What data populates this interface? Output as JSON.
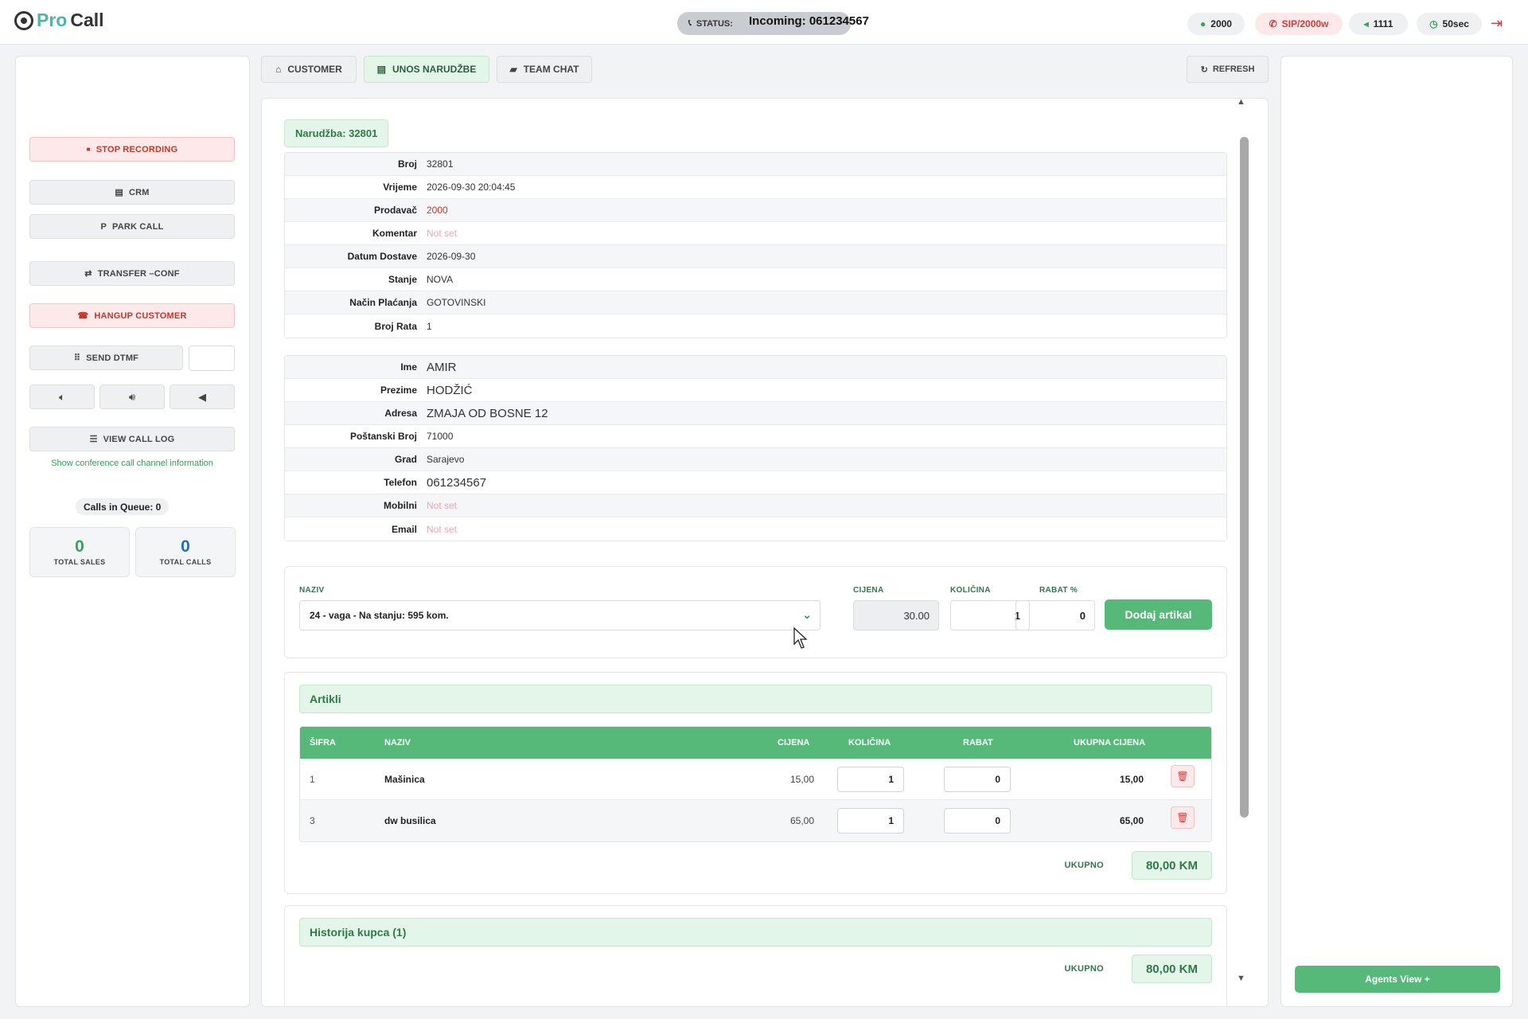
{
  "app": {
    "logo_pro": "Pro",
    "logo_call": "Call"
  },
  "topbar": {
    "status_label": "STATUS:",
    "status_value": "Incoming: 061234567",
    "agent": "2000",
    "sip": "SIP/2000w",
    "queue": "1111",
    "timer": "50sec"
  },
  "left": {
    "stop_recording": "STOP RECORDING",
    "crm": "CRM",
    "park_call": "PARK CALL",
    "transfer": "TRANSFER –CONF",
    "hangup": "HANGUP CUSTOMER",
    "send_dtmf": "SEND DTMF",
    "view_call_log": "VIEW CALL LOG",
    "conference_info": "Show conference call channel information",
    "calls_in_queue": "Calls in Queue: 0",
    "total_sales_value": "0",
    "total_sales_label": "TOTAL SALES",
    "total_calls_value": "0",
    "total_calls_label": "TOTAL CALLS"
  },
  "tabs": [
    {
      "label": "CUSTOMER"
    },
    {
      "label": "UNOS NARUDŽBE"
    },
    {
      "label": "TEAM CHAT"
    }
  ],
  "refresh_label": "REFRESH",
  "order": {
    "badge": "Narudžba: 32801",
    "rows": [
      {
        "label": "Broj",
        "value": "32801"
      },
      {
        "label": "Vrijeme",
        "value": "2026-09-30 20:04:45"
      },
      {
        "label": "Prodavač",
        "value": "2000"
      },
      {
        "label": "Komentar",
        "value": "Not set"
      },
      {
        "label": "Datum Dostave",
        "value": "2026-09-30"
      },
      {
        "label": "Stanje",
        "value": "NOVA"
      },
      {
        "label": "Način Plaćanja",
        "value": "GOTOVINSKI"
      },
      {
        "label": "Broj Rata",
        "value": "1"
      }
    ]
  },
  "customer": {
    "rows": [
      {
        "label": "Ime",
        "value": "AMIR"
      },
      {
        "label": "Prezime",
        "value": "HODŽIĆ"
      },
      {
        "label": "Adresa",
        "value": "ZMAJA OD BOSNE 12"
      },
      {
        "label": "Poštanski Broj",
        "value": "71000"
      },
      {
        "label": "Grad",
        "value": "Sarajevo"
      },
      {
        "label": "Telefon",
        "value": "061234567"
      },
      {
        "label": "Mobilni",
        "value": "Not set"
      },
      {
        "label": "Email",
        "value": "Not set"
      }
    ]
  },
  "add_item": {
    "naziv_label": "NAZIV",
    "cijena_label": "CIJENA",
    "kolicina_label": "KOLIČINA",
    "rabat_label": "RABAT %",
    "selected_product": "24 - vaga - Na stanju: 595 kom.",
    "cijena": "30.00",
    "kolicina": "1",
    "rabat": "0",
    "add_button": "Dodaj artikal"
  },
  "articles": {
    "title": "Artikli",
    "headers": {
      "sifra": "ŠIFRA",
      "naziv": "NAZIV",
      "cijena": "CIJENA",
      "kolicina": "KOLIČINA",
      "rabat": "RABAT",
      "ukupna": "UKUPNA CIJENA"
    },
    "rows": [
      {
        "sifra": "1",
        "naziv": "Mašinica",
        "cijena": "15,00",
        "kolicina": "1",
        "rabat": "0",
        "ukupna": "15,00"
      },
      {
        "sifra": "3",
        "naziv": "dw busilica",
        "cijena": "65,00",
        "kolicina": "1",
        "rabat": "0",
        "ukupna": "65,00"
      }
    ],
    "total_label": "UKUPNO",
    "total_value": "80,00 KM"
  },
  "history": {
    "title": "Historija kupca (1)",
    "total_label": "UKUPNO",
    "total_value": "80,00 KM"
  },
  "right": {
    "agents_view": "Agents View +"
  },
  "colors": {
    "accent": "#56b879",
    "danger": "#d23c3c",
    "accent_light": "#e4f5e9"
  }
}
